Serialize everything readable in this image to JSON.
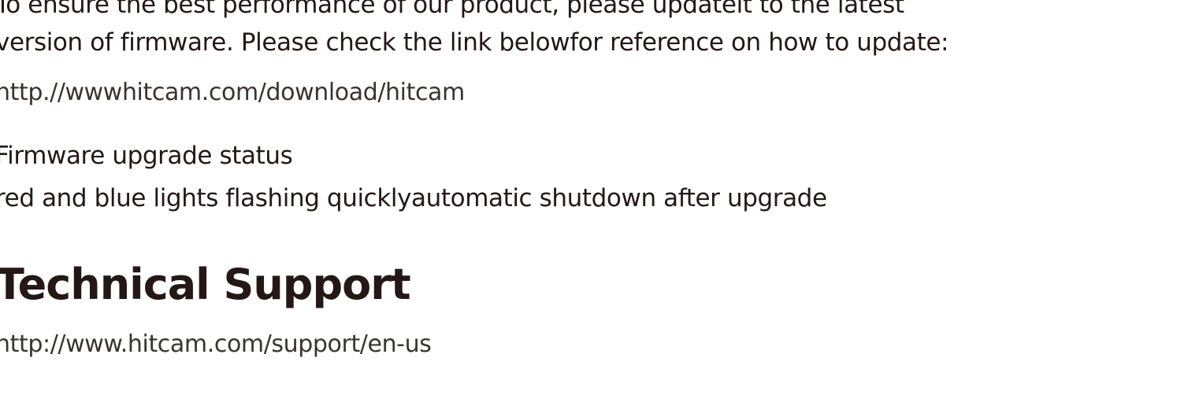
{
  "firmware": {
    "intro_line_1": "To ensure the best performance of our product, please updateit to the latest",
    "intro_line_2": "version of firmware. Please check the link belowfor reference on how to update:",
    "download_link": "http.//wwwhitcam.com/download/hitcam",
    "status_heading": "Firmware upgrade status",
    "status_text": "red and blue lights flashing quicklyautomatic shutdown after upgrade"
  },
  "support": {
    "heading": "Technical Support",
    "link": "http://www.hitcam.com/support/en-us"
  }
}
